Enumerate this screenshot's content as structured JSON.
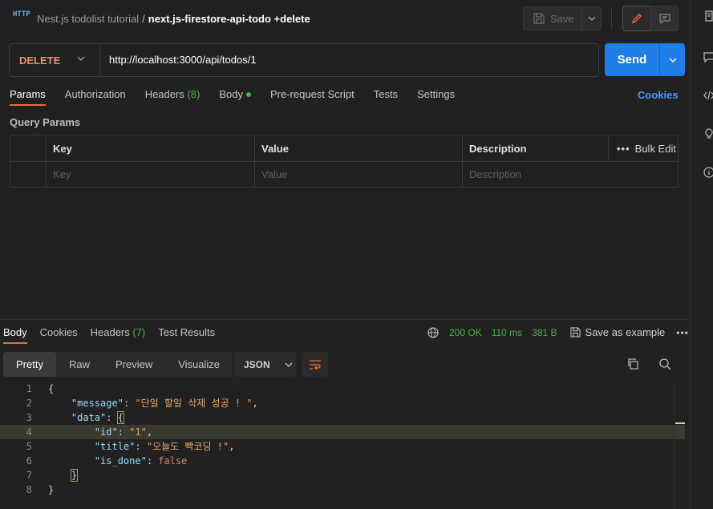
{
  "header": {
    "icon": "HTTP",
    "collection": "Nest.js todolist tutorial",
    "separator": "/",
    "request_name": "next.js-firestore-api-todo +delete",
    "save_label": "Save"
  },
  "request": {
    "method": "DELETE",
    "url": "http://localhost:3000/api/todos/1",
    "send_label": "Send",
    "method_color": "#f28b70",
    "send_color": "#1f7ee6"
  },
  "req_tabs": [
    {
      "label": "Params",
      "active": true
    },
    {
      "label": "Authorization"
    },
    {
      "label": "Headers",
      "count": "(8)"
    },
    {
      "label": "Body",
      "dot": true
    },
    {
      "label": "Pre-request Script"
    },
    {
      "label": "Tests"
    },
    {
      "label": "Settings"
    }
  ],
  "cookies_link": "Cookies",
  "query_params": {
    "title": "Query Params",
    "columns": [
      "Key",
      "Value",
      "Description"
    ],
    "placeholders": [
      "Key",
      "Value",
      "Description"
    ],
    "bulk_edit": "Bulk Edit"
  },
  "response": {
    "tabs": [
      {
        "label": "Body",
        "active": true
      },
      {
        "label": "Cookies"
      },
      {
        "label": "Headers",
        "count": "(7)"
      },
      {
        "label": "Test Results"
      }
    ],
    "status": "200 OK",
    "time": "110 ms",
    "size": "381 B",
    "save_example": "Save as example",
    "view_modes": [
      "Pretty",
      "Raw",
      "Preview",
      "Visualize"
    ],
    "format": "JSON",
    "body": {
      "message": "단일 할일 삭제 성공 ! ",
      "id": "1",
      "title": "오늘도 빡코딩 !",
      "is_done": "false"
    }
  }
}
